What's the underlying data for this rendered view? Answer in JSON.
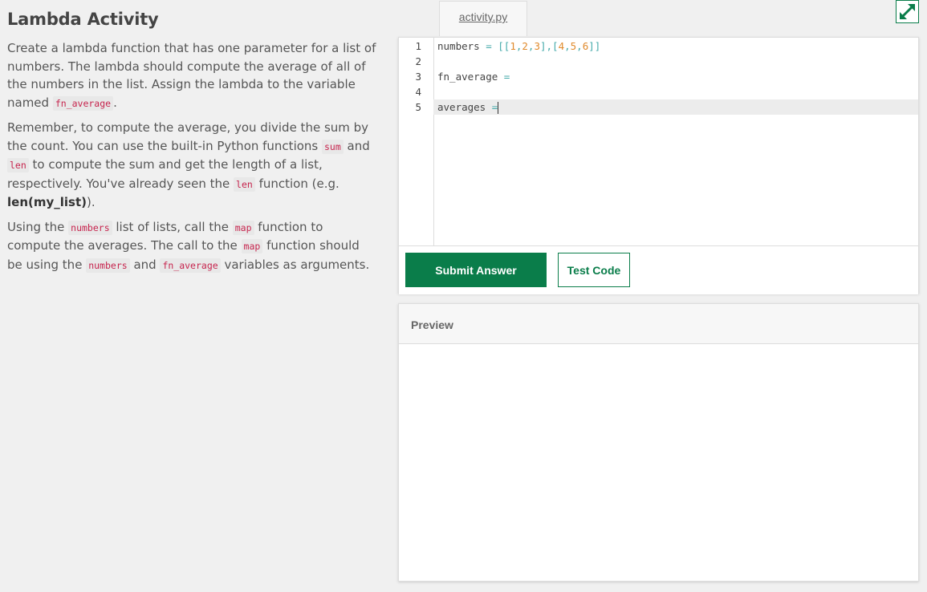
{
  "activity": {
    "title": "Lambda Activity",
    "p1": {
      "text1": "Create a lambda function that has one parameter for a list of numbers. The lambda should compute the average of all of the numbers in the list. Assign the lambda to the variable named ",
      "code1": "fn_average",
      "text2": "."
    },
    "p2": {
      "text1": "Remember, to compute the average, you divide the sum by the count. You can use the built-in Python functions ",
      "code1": "sum",
      "text2": " and ",
      "code2": "len",
      "text3": " to compute the sum and get the length of a list, respectively. You've already seen the ",
      "code3": "len",
      "text4": " function (e.g. ",
      "bold": "len(my_list)",
      "text5": ")."
    },
    "p3": {
      "text1": "Using the ",
      "code1": "numbers",
      "text2": " list of lists, call the ",
      "code2": "map",
      "text3": " function to compute the averages. The call to the ",
      "code3": "map",
      "text4": " function should be using the ",
      "code4": "numbers",
      "text5": " and ",
      "code5": "fn_average",
      "text6": " variables as arguments."
    }
  },
  "editor": {
    "tab_label": "activity.py",
    "expand_icon": "expand-arrows-icon",
    "line_numbers": [
      "1",
      "2",
      "3",
      "4",
      "5"
    ],
    "code": {
      "l1_name": "numbers",
      "l1_op": " = ",
      "l1_parts": [
        "[[",
        "1",
        ",",
        "2",
        ",",
        "3",
        "],[",
        "4",
        ",",
        "5",
        ",",
        "6",
        "]]"
      ],
      "l3_name": "fn_average",
      "l3_op": " = ",
      "l5_name": "averages",
      "l5_op": " ="
    },
    "submit_label": "Submit Answer",
    "test_label": "Test Code",
    "accent": "#0a7d4a"
  },
  "preview": {
    "header": "Preview"
  }
}
